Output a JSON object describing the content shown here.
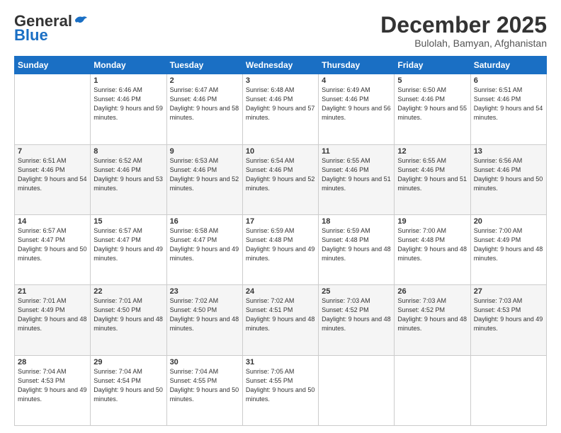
{
  "header": {
    "logo_general": "General",
    "logo_blue": "Blue",
    "month_title": "December 2025",
    "location": "Bulolah, Bamyan, Afghanistan"
  },
  "days_of_week": [
    "Sunday",
    "Monday",
    "Tuesday",
    "Wednesday",
    "Thursday",
    "Friday",
    "Saturday"
  ],
  "weeks": [
    [
      {
        "day": "",
        "sunrise": "",
        "sunset": "",
        "daylight": "",
        "empty": true
      },
      {
        "day": "1",
        "sunrise": "Sunrise: 6:46 AM",
        "sunset": "Sunset: 4:46 PM",
        "daylight": "Daylight: 9 hours and 59 minutes."
      },
      {
        "day": "2",
        "sunrise": "Sunrise: 6:47 AM",
        "sunset": "Sunset: 4:46 PM",
        "daylight": "Daylight: 9 hours and 58 minutes."
      },
      {
        "day": "3",
        "sunrise": "Sunrise: 6:48 AM",
        "sunset": "Sunset: 4:46 PM",
        "daylight": "Daylight: 9 hours and 57 minutes."
      },
      {
        "day": "4",
        "sunrise": "Sunrise: 6:49 AM",
        "sunset": "Sunset: 4:46 PM",
        "daylight": "Daylight: 9 hours and 56 minutes."
      },
      {
        "day": "5",
        "sunrise": "Sunrise: 6:50 AM",
        "sunset": "Sunset: 4:46 PM",
        "daylight": "Daylight: 9 hours and 55 minutes."
      },
      {
        "day": "6",
        "sunrise": "Sunrise: 6:51 AM",
        "sunset": "Sunset: 4:46 PM",
        "daylight": "Daylight: 9 hours and 54 minutes."
      }
    ],
    [
      {
        "day": "7",
        "sunrise": "Sunrise: 6:51 AM",
        "sunset": "Sunset: 4:46 PM",
        "daylight": "Daylight: 9 hours and 54 minutes."
      },
      {
        "day": "8",
        "sunrise": "Sunrise: 6:52 AM",
        "sunset": "Sunset: 4:46 PM",
        "daylight": "Daylight: 9 hours and 53 minutes."
      },
      {
        "day": "9",
        "sunrise": "Sunrise: 6:53 AM",
        "sunset": "Sunset: 4:46 PM",
        "daylight": "Daylight: 9 hours and 52 minutes."
      },
      {
        "day": "10",
        "sunrise": "Sunrise: 6:54 AM",
        "sunset": "Sunset: 4:46 PM",
        "daylight": "Daylight: 9 hours and 52 minutes."
      },
      {
        "day": "11",
        "sunrise": "Sunrise: 6:55 AM",
        "sunset": "Sunset: 4:46 PM",
        "daylight": "Daylight: 9 hours and 51 minutes."
      },
      {
        "day": "12",
        "sunrise": "Sunrise: 6:55 AM",
        "sunset": "Sunset: 4:46 PM",
        "daylight": "Daylight: 9 hours and 51 minutes."
      },
      {
        "day": "13",
        "sunrise": "Sunrise: 6:56 AM",
        "sunset": "Sunset: 4:46 PM",
        "daylight": "Daylight: 9 hours and 50 minutes."
      }
    ],
    [
      {
        "day": "14",
        "sunrise": "Sunrise: 6:57 AM",
        "sunset": "Sunset: 4:47 PM",
        "daylight": "Daylight: 9 hours and 50 minutes."
      },
      {
        "day": "15",
        "sunrise": "Sunrise: 6:57 AM",
        "sunset": "Sunset: 4:47 PM",
        "daylight": "Daylight: 9 hours and 49 minutes."
      },
      {
        "day": "16",
        "sunrise": "Sunrise: 6:58 AM",
        "sunset": "Sunset: 4:47 PM",
        "daylight": "Daylight: 9 hours and 49 minutes."
      },
      {
        "day": "17",
        "sunrise": "Sunrise: 6:59 AM",
        "sunset": "Sunset: 4:48 PM",
        "daylight": "Daylight: 9 hours and 49 minutes."
      },
      {
        "day": "18",
        "sunrise": "Sunrise: 6:59 AM",
        "sunset": "Sunset: 4:48 PM",
        "daylight": "Daylight: 9 hours and 48 minutes."
      },
      {
        "day": "19",
        "sunrise": "Sunrise: 7:00 AM",
        "sunset": "Sunset: 4:48 PM",
        "daylight": "Daylight: 9 hours and 48 minutes."
      },
      {
        "day": "20",
        "sunrise": "Sunrise: 7:00 AM",
        "sunset": "Sunset: 4:49 PM",
        "daylight": "Daylight: 9 hours and 48 minutes."
      }
    ],
    [
      {
        "day": "21",
        "sunrise": "Sunrise: 7:01 AM",
        "sunset": "Sunset: 4:49 PM",
        "daylight": "Daylight: 9 hours and 48 minutes."
      },
      {
        "day": "22",
        "sunrise": "Sunrise: 7:01 AM",
        "sunset": "Sunset: 4:50 PM",
        "daylight": "Daylight: 9 hours and 48 minutes."
      },
      {
        "day": "23",
        "sunrise": "Sunrise: 7:02 AM",
        "sunset": "Sunset: 4:50 PM",
        "daylight": "Daylight: 9 hours and 48 minutes."
      },
      {
        "day": "24",
        "sunrise": "Sunrise: 7:02 AM",
        "sunset": "Sunset: 4:51 PM",
        "daylight": "Daylight: 9 hours and 48 minutes."
      },
      {
        "day": "25",
        "sunrise": "Sunrise: 7:03 AM",
        "sunset": "Sunset: 4:52 PM",
        "daylight": "Daylight: 9 hours and 48 minutes."
      },
      {
        "day": "26",
        "sunrise": "Sunrise: 7:03 AM",
        "sunset": "Sunset: 4:52 PM",
        "daylight": "Daylight: 9 hours and 48 minutes."
      },
      {
        "day": "27",
        "sunrise": "Sunrise: 7:03 AM",
        "sunset": "Sunset: 4:53 PM",
        "daylight": "Daylight: 9 hours and 49 minutes."
      }
    ],
    [
      {
        "day": "28",
        "sunrise": "Sunrise: 7:04 AM",
        "sunset": "Sunset: 4:53 PM",
        "daylight": "Daylight: 9 hours and 49 minutes."
      },
      {
        "day": "29",
        "sunrise": "Sunrise: 7:04 AM",
        "sunset": "Sunset: 4:54 PM",
        "daylight": "Daylight: 9 hours and 50 minutes."
      },
      {
        "day": "30",
        "sunrise": "Sunrise: 7:04 AM",
        "sunset": "Sunset: 4:55 PM",
        "daylight": "Daylight: 9 hours and 50 minutes."
      },
      {
        "day": "31",
        "sunrise": "Sunrise: 7:05 AM",
        "sunset": "Sunset: 4:55 PM",
        "daylight": "Daylight: 9 hours and 50 minutes."
      },
      {
        "day": "",
        "sunrise": "",
        "sunset": "",
        "daylight": "",
        "empty": true
      },
      {
        "day": "",
        "sunrise": "",
        "sunset": "",
        "daylight": "",
        "empty": true
      },
      {
        "day": "",
        "sunrise": "",
        "sunset": "",
        "daylight": "",
        "empty": true
      }
    ]
  ]
}
